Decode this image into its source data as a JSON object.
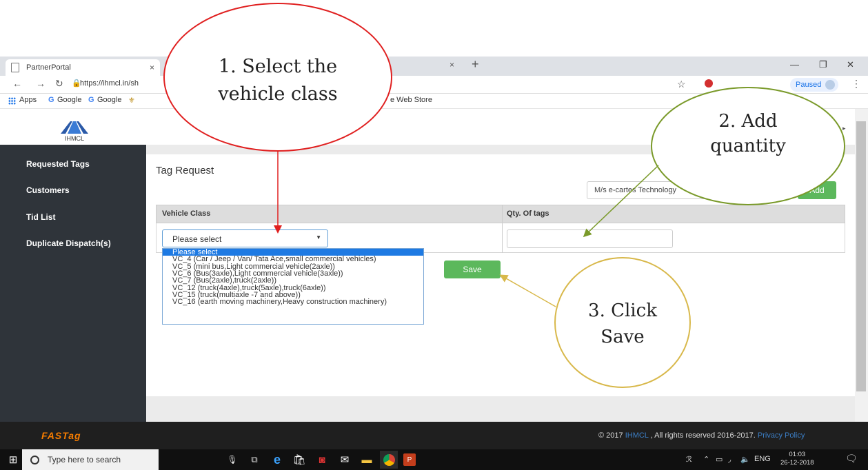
{
  "browser": {
    "tab_title": "PartnerPortal",
    "tab_close": "×",
    "tab2_close": "×",
    "new_tab": "+",
    "url": "https://ihmcl.in/sh",
    "paused_label": "Paused",
    "bookmarks": [
      "Apps",
      "Google",
      "Google",
      "e Web Store"
    ]
  },
  "sidebar": {
    "items": [
      "Requested Tags",
      "Customers",
      "Tid List",
      "Duplicate Dispatch(s)"
    ]
  },
  "logo": {
    "text": "IHMCL"
  },
  "main": {
    "title": "Tag Request",
    "org_value": "M/s e-cartes Technology",
    "add_label": "Add",
    "col_vehicle": "Vehicle Class",
    "col_qty": "Qty. Of tags",
    "select_value": "Please select",
    "options": [
      "Please select",
      "VC_4 (Car / Jeep / Van/ Tata Ace,small commercial vehicles)",
      "VC_5 (mini bus,Light commercial vehicle(2axle))",
      "VC_6 (Bus(3axle),Light commercial vehicle(3axle))",
      "VC_7 (Bus(2axle),truck(2axle))",
      "VC_12 (truck(4axle),truck(5axle),truck(6axle))",
      "VC_15 (truck(multiaxle -7 and above))",
      "VC_16 (earth moving machinery,Heavy construction machinery)"
    ],
    "save_label": "Save"
  },
  "footer": {
    "brand": "FASTag",
    "copy_prefix": "© 2017 ",
    "copy_link": "IHMCL",
    "copy_mid": " , All rights reserved 2016-2017. ",
    "privacy": "Privacy Policy"
  },
  "taskbar": {
    "search_placeholder": "Type here to search",
    "lang": "ENG",
    "time": "01:03",
    "date": "26-12-2018"
  },
  "annotations": {
    "step1_line1": "1. Select the",
    "step1_line2": "vehicle class",
    "step2_line1": "2. Add",
    "step2_line2": "quantity",
    "step3_line1": "3. Click",
    "step3_line2": "Save"
  },
  "colors": {
    "sidebar": "#2f343a",
    "button_green": "#5cb85c",
    "selected_option": "#1e7ae3",
    "annot_red": "#e02020",
    "annot_olive": "#7a9a2a",
    "annot_gold": "#d8b84a"
  }
}
